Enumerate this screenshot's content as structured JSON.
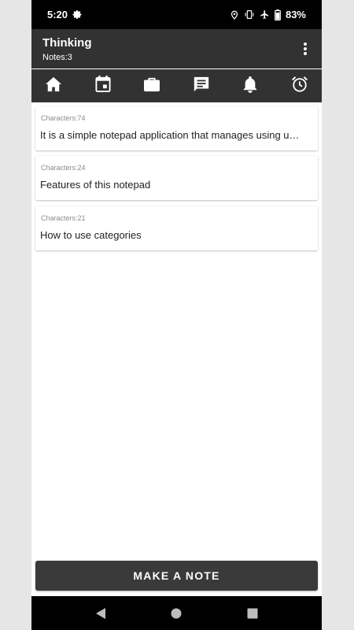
{
  "status_bar": {
    "time": "5:20",
    "battery": "83%",
    "icons": [
      "settings-gear-icon",
      "location-icon",
      "vibrate-icon",
      "airplane-icon",
      "battery-icon"
    ]
  },
  "app_bar": {
    "title": "Thinking",
    "subtitle": "Notes:3",
    "menu_icon": "more-vert-icon"
  },
  "tabs": [
    {
      "icon": "home-icon"
    },
    {
      "icon": "calendar-icon"
    },
    {
      "icon": "briefcase-icon"
    },
    {
      "icon": "chat-icon"
    },
    {
      "icon": "bell-icon"
    },
    {
      "icon": "alarm-clock-icon"
    }
  ],
  "notes": [
    {
      "count": "Characters:74",
      "text": "It is a simple notepad application that manages using up to six categories"
    },
    {
      "count": "Characters:24",
      "text": "Features of this notepad"
    },
    {
      "count": "Characters:21",
      "text": "How to use categories"
    }
  ],
  "make_note_label": "MAKE A NOTE",
  "nav_bar": {
    "icons": [
      "back-icon",
      "home-circle-icon",
      "recents-icon"
    ]
  },
  "colors": {
    "bar": "#323232",
    "status": "#000000",
    "button": "#3a3a3a"
  }
}
